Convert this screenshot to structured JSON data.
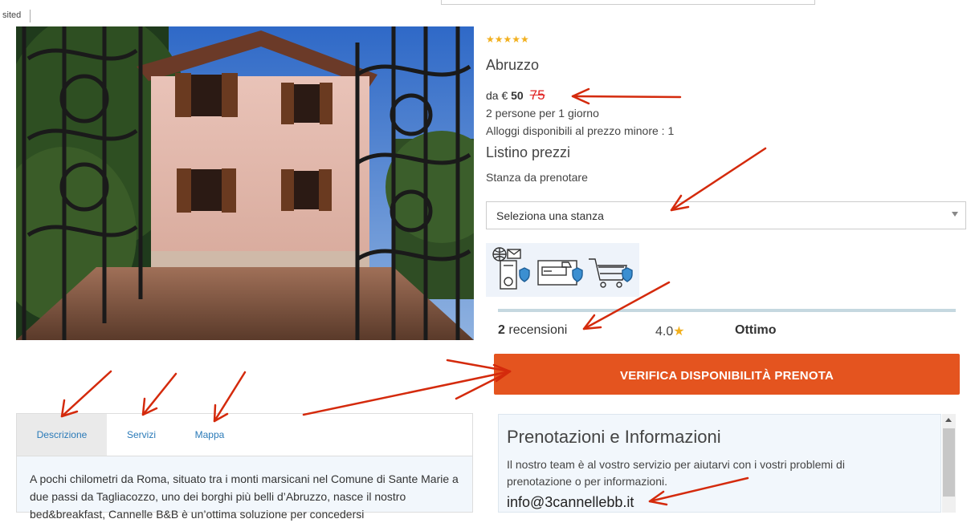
{
  "browser": {
    "visited_label": "sited"
  },
  "listing": {
    "stars": "★★★★★",
    "region": "Abruzzo",
    "price_prefix": "da €",
    "price_current": "50",
    "price_old": "75",
    "persons": "2 persone per 1 giorno",
    "alloggi": "Alloggi disponibili al prezzo minore : 1",
    "listino_title": "Listino prezzi",
    "stanza_label": "Stanza da prenotare",
    "select_value": "Seleziona una stanza"
  },
  "reviews": {
    "count": "2",
    "label": "recensioni",
    "score": "4.0",
    "star": "★",
    "verdict": "Ottimo"
  },
  "cta": {
    "label": "VERIFICA DISPONIBILITÀ  PRENOTA"
  },
  "tabs": {
    "items": [
      {
        "label": "Descrizione"
      },
      {
        "label": "Servizi"
      },
      {
        "label": "Mappa"
      }
    ],
    "description": "A pochi chilometri da Roma, situato tra i monti marsicani nel Comune di Sante Marie a due passi da Tagliacozzo, uno dei borghi più belli d’Abruzzo, nasce il nostro bed&breakfast, Cannelle B&B è un’ottima soluzione per concedersi"
  },
  "info": {
    "title": "Prenotazioni e Informazioni",
    "text": "Il nostro team è al vostro servizio per aiutarvi con i vostri problemi di prenotazione o per informazioni.",
    "email": "info@3cannellebb.it"
  },
  "icons": {
    "payment": [
      "globe-mail-server-icon",
      "credit-card-terminal-icon",
      "shopping-cart-icon"
    ]
  },
  "colors": {
    "accent": "#e4541f",
    "link": "#2a7ab8",
    "annotation": "#d42a0c",
    "star": "#f2b01e"
  }
}
